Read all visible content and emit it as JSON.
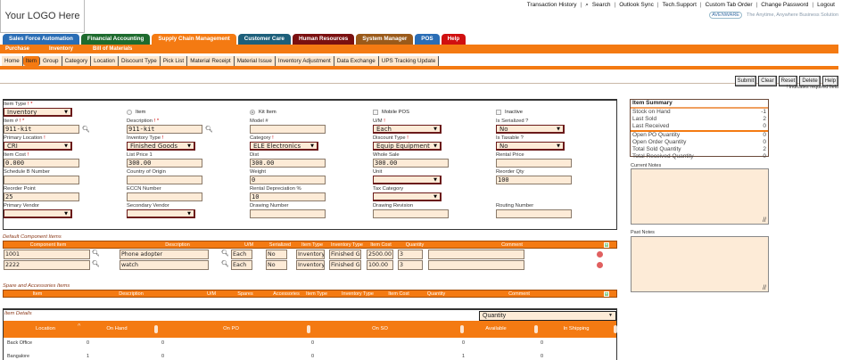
{
  "logo": "Your LOGO Here",
  "top_links": [
    "Transaction History",
    "Search",
    "Outlook Sync",
    "Tech.Support",
    "Custom Tab Order",
    "Change Password",
    "Logout"
  ],
  "brand": {
    "name": "AVENWARE",
    "tagline": "The Anytime, Anywhere Business Solution"
  },
  "module_tabs": [
    {
      "label": "Sales Force Automation",
      "color": "#2a6db5"
    },
    {
      "label": "Financial Accounting",
      "color": "#1e6b2e"
    },
    {
      "label": "Supply Chain Management",
      "color": "#f47a12"
    },
    {
      "label": "Customer Care",
      "color": "#1d5f7a"
    },
    {
      "label": "Human Resources",
      "color": "#7a1010"
    },
    {
      "label": "System Manager",
      "color": "#9a5a1a"
    },
    {
      "label": "POS",
      "color": "#2a6db5"
    },
    {
      "label": "Help",
      "color": "#d01010"
    }
  ],
  "sub_modules": [
    "Purchase",
    "Inventory",
    "Bill of Materials"
  ],
  "menu_tabs": [
    "Home",
    "Item",
    "Group",
    "Category",
    "Location",
    "Discount Type",
    "Pick List",
    "Material Receipt",
    "Material Issue",
    "Inventory Adjustment",
    "Data Exchange",
    "UPS Tracking Update"
  ],
  "active_menu_tab": "Item",
  "buttons": [
    "Submit",
    "Clear",
    "Reset",
    "Delete",
    "Help"
  ],
  "required_note": "! Indicates required field",
  "form": [
    {
      "label": "Item Type",
      "req": "! *",
      "type": "select",
      "value": "Inventory"
    },
    {
      "label": "Item",
      "type": "radio",
      "checked": false
    },
    {
      "label": "Kit Item",
      "type": "radio",
      "checked": true
    },
    {
      "label": "Mobile POS",
      "type": "checkbox",
      "checked": false
    },
    {
      "label": "Inactive",
      "type": "checkbox",
      "checked": false
    },
    {
      "label": "Item #",
      "req": "! *",
      "type": "text",
      "value": "911-kit",
      "search": true
    },
    {
      "label": "Description",
      "req": "! *",
      "type": "text",
      "value": "911-kit",
      "search": true
    },
    {
      "label": "Model #",
      "type": "text",
      "value": ""
    },
    {
      "label": "U/M",
      "req": "!",
      "type": "select",
      "value": "Each"
    },
    {
      "label": "Is Serialized ?",
      "type": "select",
      "value": "No"
    },
    {
      "label": "Primary Location",
      "req": "!",
      "type": "select",
      "value": "CRI"
    },
    {
      "label": "Inventory Type",
      "req": "!",
      "type": "select",
      "value": "Finished Goods"
    },
    {
      "label": "Category",
      "req": "!",
      "type": "select",
      "value": "ELE Electronics"
    },
    {
      "label": "Discount Type",
      "req": "!",
      "type": "select",
      "value": "Equip Equipment"
    },
    {
      "label": "Is Taxable ?",
      "type": "select",
      "value": "No"
    },
    {
      "label": "Item Cost",
      "req": "!",
      "type": "text",
      "value": "0.000"
    },
    {
      "label": "List Price 1",
      "type": "text",
      "value": "300.00"
    },
    {
      "label": "Dist",
      "type": "text",
      "value": "300.00"
    },
    {
      "label": "Whole Sale",
      "type": "text",
      "value": "300.00"
    },
    {
      "label": "Rental Price",
      "type": "text",
      "value": ""
    },
    {
      "label": "Schedule B Number",
      "type": "text",
      "value": ""
    },
    {
      "label": "Country of Origin",
      "type": "text",
      "value": ""
    },
    {
      "label": "Weight",
      "type": "text",
      "value": "0"
    },
    {
      "label": "Unit",
      "type": "select",
      "value": ""
    },
    {
      "label": "Reorder Qty",
      "type": "text",
      "value": "100"
    },
    {
      "label": "Reorder Point",
      "type": "text",
      "value": "25"
    },
    {
      "label": "ECCN Number",
      "type": "text",
      "value": ""
    },
    {
      "label": "Rental Depreciation %",
      "type": "text",
      "value": "10"
    },
    {
      "label": "Tax Category",
      "type": "select",
      "value": ""
    },
    {
      "label": "",
      "type": "empty"
    },
    {
      "label": "Primary Vendor",
      "type": "select",
      "value": ""
    },
    {
      "label": "Secondary Vendor",
      "type": "select",
      "value": ""
    },
    {
      "label": "Drawing Number",
      "type": "text",
      "value": ""
    },
    {
      "label": "Drawing Revision",
      "type": "text",
      "value": ""
    },
    {
      "label": "Routing Number",
      "type": "text",
      "value": ""
    }
  ],
  "summary": {
    "title": "Item Summary",
    "rows_top": [
      [
        "Stock on Hand",
        "-1"
      ],
      [
        "Last Sold",
        "2"
      ],
      [
        "Last Received",
        "0"
      ]
    ],
    "rows_bottom": [
      [
        "Open PO Quantity",
        "0"
      ],
      [
        "Open Order Quantity",
        "0"
      ],
      [
        "Total Sold Quantity",
        "2"
      ],
      [
        "Total Received Quantity",
        "0"
      ]
    ]
  },
  "current_notes_label": "Current Notes",
  "past_notes_label": "Past Notes",
  "components": {
    "title": "Default Component Items",
    "headers": [
      "Component Item",
      "Description",
      "U/M",
      "Serialized",
      "Item Type",
      "Inventory Type",
      "Item Cost",
      "Quantity",
      "Comment"
    ],
    "rows": [
      [
        "1001",
        "Phone adopter",
        "Each",
        "No",
        "Inventory",
        "Finished Goods",
        "2500.00",
        "3",
        ""
      ],
      [
        "2222",
        "watch",
        "Each",
        "No",
        "Inventory",
        "Finished Goods",
        "100.00",
        "3",
        ""
      ]
    ]
  },
  "spares": {
    "title": "Spare and Accessories Items",
    "headers": [
      "Item",
      "Description",
      "U/M",
      "Spares",
      "Accessories",
      "Item Type",
      "Inventory Type",
      "Item Cost",
      "Quantity",
      "Comment"
    ]
  },
  "details": {
    "title": "Item Details",
    "view_select": "Quantity",
    "headers": [
      "Location",
      "On Hand",
      "On PO",
      "On SO",
      "Available",
      "In Shipping"
    ],
    "rows": [
      [
        "Back Office",
        "0",
        "0",
        "0",
        "0",
        "0"
      ],
      [
        "Bangalore",
        "1",
        "0",
        "0",
        "1",
        "0"
      ]
    ]
  }
}
